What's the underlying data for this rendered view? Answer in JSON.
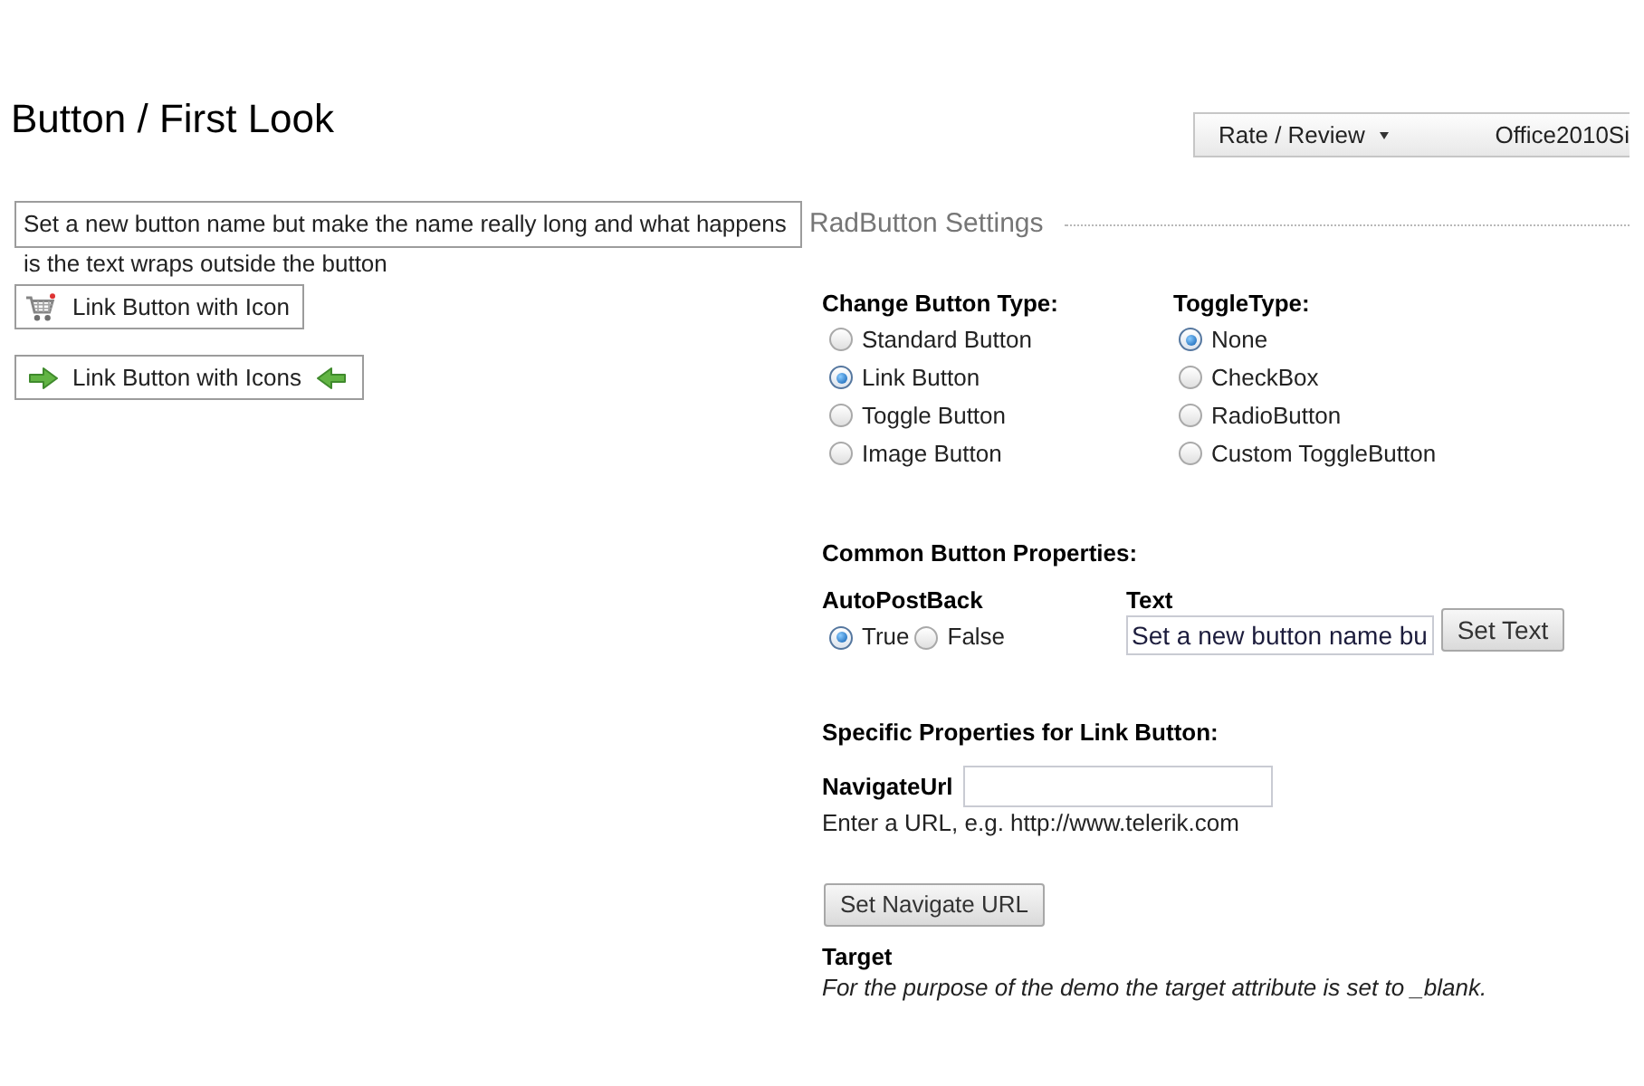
{
  "page": {
    "title": "Button / First Look"
  },
  "toolbar": {
    "rate_review": "Rate / Review",
    "skin": "Office2010Si"
  },
  "demo_buttons": [
    {
      "kind": "wrapping",
      "label": "Set a new button name but make the name really long and what happens is the text wraps outside the button"
    },
    {
      "kind": "cart",
      "label": "Link Button with Icon"
    },
    {
      "kind": "arrows",
      "label": "Link Button with Icons"
    }
  ],
  "settings": {
    "title": "RadButton Settings",
    "button_type": {
      "heading": "Change Button Type:",
      "options": [
        {
          "label": "Standard Button",
          "selected": false
        },
        {
          "label": "Link Button",
          "selected": true
        },
        {
          "label": "Toggle Button",
          "selected": false
        },
        {
          "label": "Image Button",
          "selected": false
        }
      ]
    },
    "toggle_type": {
      "heading": "ToggleType:",
      "options": [
        {
          "label": "None",
          "selected": true
        },
        {
          "label": "CheckBox",
          "selected": false
        },
        {
          "label": "RadioButton",
          "selected": false
        },
        {
          "label": "Custom ToggleButton",
          "selected": false
        }
      ]
    },
    "common": {
      "heading": "Common Button Properties:",
      "autopostback": {
        "label": "AutoPostBack",
        "options": [
          {
            "label": "True",
            "selected": true
          },
          {
            "label": "False",
            "selected": false
          }
        ]
      },
      "text": {
        "label": "Text",
        "value": "Set a new button name bu",
        "button": "Set Text"
      }
    },
    "specific": {
      "heading": "Specific Properties for Link Button:",
      "navigate_url": {
        "label": "NavigateUrl",
        "hint": "Enter a URL, e.g. http://www.telerik.com",
        "button": "Set Navigate URL"
      },
      "target": {
        "label": "Target",
        "note": "For the purpose of the demo the target attribute is set to _blank."
      }
    }
  }
}
